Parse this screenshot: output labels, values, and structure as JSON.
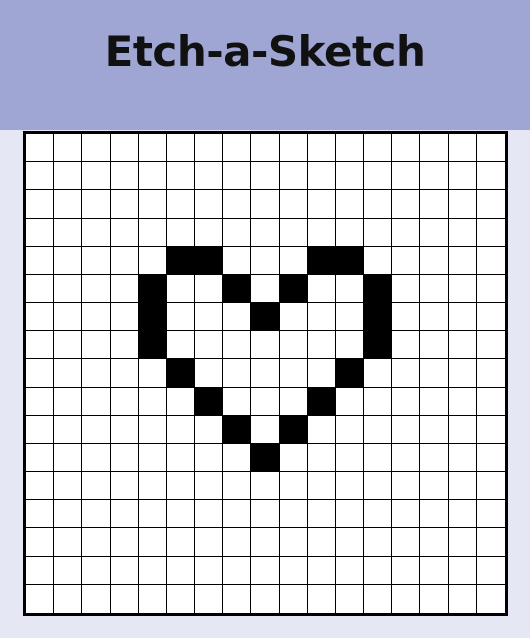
{
  "header": {
    "title": "Etch-a-Sketch"
  },
  "colors": {
    "header_bg": "#a0a6d3",
    "page_bg": "#e6e7f4",
    "cell_empty": "#ffffff",
    "cell_filled": "#000000",
    "grid_line": "#000000"
  },
  "grid": {
    "rows": 17,
    "cols": 17,
    "filled_cells": [
      [
        4,
        5
      ],
      [
        4,
        6
      ],
      [
        4,
        10
      ],
      [
        4,
        11
      ],
      [
        5,
        4
      ],
      [
        5,
        7
      ],
      [
        5,
        9
      ],
      [
        5,
        12
      ],
      [
        6,
        4
      ],
      [
        6,
        8
      ],
      [
        6,
        12
      ],
      [
        7,
        4
      ],
      [
        7,
        12
      ],
      [
        8,
        5
      ],
      [
        8,
        11
      ],
      [
        9,
        6
      ],
      [
        9,
        10
      ],
      [
        10,
        7
      ],
      [
        10,
        9
      ],
      [
        11,
        8
      ]
    ]
  }
}
